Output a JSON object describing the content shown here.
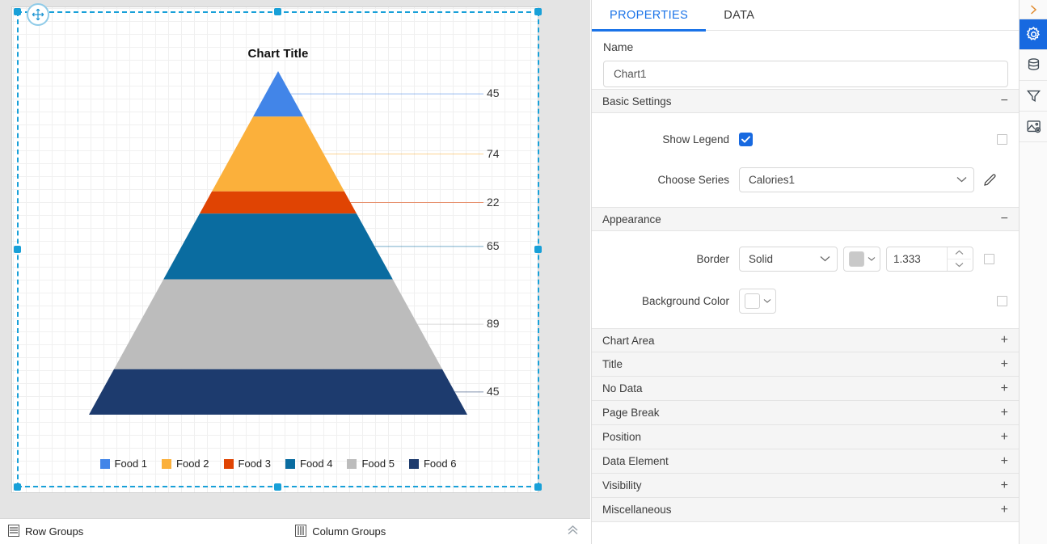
{
  "design": {
    "chart_title": "Chart Title",
    "move_handle_icon": "move-cross-icon"
  },
  "chart_data": {
    "type": "pie",
    "subtype": "pyramid",
    "title": "Chart Title",
    "categories": [
      "Food 1",
      "Food 2",
      "Food 3",
      "Food 4",
      "Food 5",
      "Food 6"
    ],
    "values": [
      45,
      74,
      22,
      65,
      89,
      45
    ],
    "colors": [
      "#4285e8",
      "#fbb03b",
      "#e04403",
      "#0a6ca0",
      "#bcbcbc",
      "#1d3b6e"
    ],
    "series_name": "Calories1",
    "legend": {
      "show": true,
      "position": "bottom"
    },
    "labels_shown": true,
    "label_positions": "outside-right-with-leader-lines",
    "grid": true
  },
  "bottom_bar": {
    "row_groups_label": "Row Groups",
    "row_groups_icon": "rows-icon",
    "column_groups_label": "Column Groups",
    "column_groups_icon": "columns-icon",
    "collapse_icon": "chevron-double-up-icon"
  },
  "properties_panel": {
    "tabs": [
      {
        "label": "PROPERTIES",
        "active": true
      },
      {
        "label": "DATA",
        "active": false
      }
    ],
    "name": {
      "label": "Name",
      "value": "Chart1",
      "placeholder": "Name"
    },
    "basic_settings": {
      "header": "Basic Settings",
      "sign": "−",
      "show_legend": {
        "label": "Show Legend",
        "checked": true,
        "check_glyph": "✓"
      },
      "choose_series": {
        "label": "Choose Series",
        "value": "Calories1",
        "edit_icon": "pencil-icon",
        "chevron_icon": "chevron-down-icon"
      }
    },
    "appearance": {
      "header": "Appearance",
      "sign": "−",
      "border": {
        "label": "Border",
        "style_value": "Solid",
        "color_value": "#c9c9c9",
        "width_value": "1.333",
        "chevron_icon": "chevron-down-icon",
        "spinner_up_icon": "chevron-up-icon",
        "spinner_down_icon": "chevron-down-icon"
      },
      "background_color": {
        "label": "Background Color",
        "color_value": "#ffffff",
        "chevron_icon": "chevron-down-icon"
      }
    },
    "collapsed_sections": [
      {
        "label": "Chart Area",
        "sign": "+"
      },
      {
        "label": "Title",
        "sign": "+"
      },
      {
        "label": "No Data",
        "sign": "+"
      },
      {
        "label": "Page Break",
        "sign": "+"
      },
      {
        "label": "Position",
        "sign": "+"
      },
      {
        "label": "Data Element",
        "sign": "+"
      },
      {
        "label": "Visibility",
        "sign": "+"
      },
      {
        "label": "Miscellaneous",
        "sign": "+"
      }
    ]
  },
  "icon_rail": [
    {
      "name": "expand-chevron-icon",
      "active": false
    },
    {
      "name": "gear-icon",
      "active": true
    },
    {
      "name": "database-icon",
      "active": false
    },
    {
      "name": "filter-icon",
      "active": false
    },
    {
      "name": "image-settings-icon",
      "active": false
    }
  ],
  "theme": {
    "accent": "#1a73e8",
    "selection": "#18a0d8",
    "panel_bg": "#f5f5f5"
  }
}
